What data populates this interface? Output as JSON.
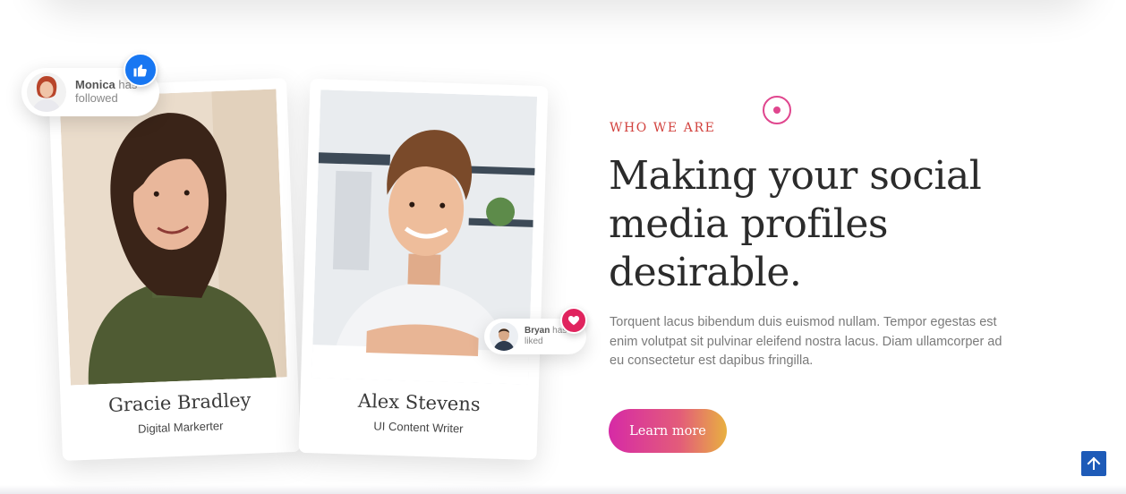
{
  "cards": [
    {
      "name": "Gracie Bradley",
      "role": "Digital Markerter"
    },
    {
      "name": "Alex Stevens",
      "role": "UI Content Writer"
    }
  ],
  "notifications": {
    "follow": {
      "name": "Monica",
      "action": "has",
      "action2": "followed"
    },
    "like": {
      "name": "Bryan",
      "action": "has",
      "action2": "liked"
    }
  },
  "section": {
    "eyebrow": "WHO WE ARE",
    "headline_lines": [
      "Making your social",
      "media profiles",
      "desirable."
    ],
    "body": "Torquent lacus bibendum duis euismod nullam. Tempor egestas est enim volutpat sit pulvinar eleifend nostra lacus. Diam ullamcorper ad eu consectetur est dapibus fringilla.",
    "cta_label": "Learn more"
  },
  "icons": {
    "like": "thumbs-up-icon",
    "heart": "heart-icon",
    "scroll_top": "arrow-up-icon"
  },
  "colors": {
    "accent": "#e0468e",
    "eyebrow": "#d2413d",
    "like_badge": "#1877f2",
    "heart_badge": "#e0245e",
    "scroll_top": "#1e5bb8"
  }
}
